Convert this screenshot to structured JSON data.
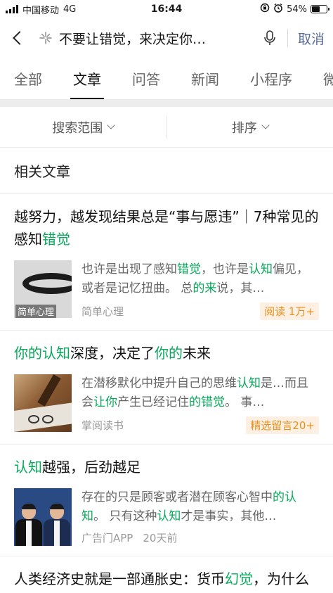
{
  "status": {
    "carrier": "中国移动",
    "network": "4G",
    "time": "16:44",
    "battery": "54%",
    "battery_level": 0.54
  },
  "search": {
    "query": "不要让错觉，来决定你…",
    "cancel_label": "取消"
  },
  "tabs": [
    "全部",
    "文章",
    "问答",
    "新闻",
    "小程序",
    "微"
  ],
  "active_tab": 1,
  "filters": {
    "scope_label": "搜索范围",
    "sort_label": "排序"
  },
  "section_title": "相关文章",
  "articles": [
    {
      "title_parts": [
        {
          "text": "越努力，越发现结果总是“事与愿违”｜7种常见的感知",
          "hl": false
        },
        {
          "text": "错觉",
          "hl": true
        }
      ],
      "snippet_parts": [
        {
          "text": "也许是出现了感知",
          "hl": false
        },
        {
          "text": "错觉",
          "hl": true
        },
        {
          "text": "，也许是",
          "hl": false
        },
        {
          "text": "认知",
          "hl": true
        },
        {
          "text": "偏见，或者是记忆扭曲。 总",
          "hl": false
        },
        {
          "text": "的来",
          "hl": true
        },
        {
          "text": "说，其…",
          "hl": false
        }
      ],
      "source": "简单心理",
      "thumb_caption": "简单心理",
      "time": "",
      "badge": "阅读 1万+"
    },
    {
      "title_parts": [
        {
          "text": "你的认知",
          "hl": true
        },
        {
          "text": "深度，决定了",
          "hl": false
        },
        {
          "text": "你的",
          "hl": true
        },
        {
          "text": "未来",
          "hl": false
        }
      ],
      "snippet_parts": [
        {
          "text": "在潜移默化中提升自己的思维",
          "hl": false
        },
        {
          "text": "认知",
          "hl": true
        },
        {
          "text": "是…而且会",
          "hl": false
        },
        {
          "text": "让你",
          "hl": true
        },
        {
          "text": "产生已经记住",
          "hl": false
        },
        {
          "text": "的错觉",
          "hl": true
        },
        {
          "text": "。 事…",
          "hl": false
        }
      ],
      "source": "掌阅读书",
      "time": "",
      "badge": "精选留言20+"
    },
    {
      "title_parts": [
        {
          "text": "认知",
          "hl": true
        },
        {
          "text": "越强，后劲越足",
          "hl": false
        }
      ],
      "snippet_parts": [
        {
          "text": "存在的只是顾客或者潜在顾客心智中",
          "hl": false
        },
        {
          "text": "的认知",
          "hl": true
        },
        {
          "text": "。 只有这种",
          "hl": false
        },
        {
          "text": "认知",
          "hl": true
        },
        {
          "text": "才是事实，其他…",
          "hl": false
        }
      ],
      "source": "广告门APP",
      "time": "20天前",
      "badge": ""
    }
  ],
  "last_article": {
    "title_parts": [
      {
        "text": "人类经济史就是一部通胀史：货币",
        "hl": false
      },
      {
        "text": "幻觉",
        "hl": true
      },
      {
        "text": "，为什么放水未必通胀？通缩=痛苦？",
        "hl": false
      }
    ]
  },
  "colors": {
    "highlight": "#07a85a",
    "link": "#576b95",
    "badge_bg": "#fdf0e2",
    "badge_text": "#e8901d"
  }
}
